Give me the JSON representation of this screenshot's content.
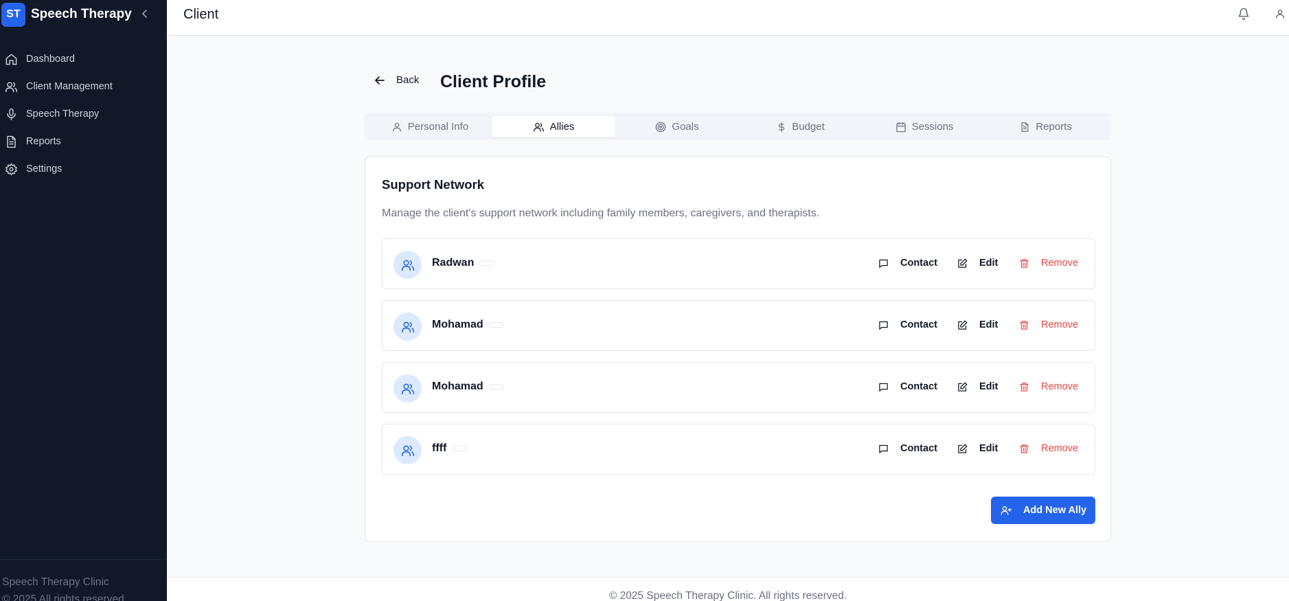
{
  "sidebar": {
    "brand_badge": "ST",
    "brand_name": "Speech Therapy",
    "items": [
      {
        "label": "Dashboard",
        "icon": "home-icon"
      },
      {
        "label": "Client Management",
        "icon": "users-icon"
      },
      {
        "label": "Speech Therapy",
        "icon": "microphone-icon"
      },
      {
        "label": "Reports",
        "icon": "file-text-icon"
      },
      {
        "label": "Settings",
        "icon": "gear-icon"
      }
    ],
    "footer_line1": "Speech Therapy Clinic",
    "footer_line2": "© 2025 All rights reserved"
  },
  "header": {
    "title": "Client"
  },
  "page": {
    "back_label": "Back",
    "title": "Client Profile"
  },
  "tabs": [
    {
      "label": "Personal Info",
      "icon": "user-icon"
    },
    {
      "label": "Allies",
      "icon": "users-icon",
      "active": true
    },
    {
      "label": "Goals",
      "icon": "target-icon"
    },
    {
      "label": "Budget",
      "icon": "dollar-icon"
    },
    {
      "label": "Sessions",
      "icon": "calendar-icon"
    },
    {
      "label": "Reports",
      "icon": "file-text-icon"
    }
  ],
  "support": {
    "title": "Support Network",
    "description": "Manage the client's support network including family members, caregivers, and therapists.",
    "allies": [
      {
        "name": "Radwan"
      },
      {
        "name": "Mohamad"
      },
      {
        "name": "Mohamad"
      },
      {
        "name": "ffff"
      }
    ],
    "actions": {
      "contact": "Contact",
      "edit": "Edit",
      "remove": "Remove"
    },
    "add_label": "Add New Ally"
  },
  "footer": {
    "text": "© 2025 Speech Therapy Clinic. All rights reserved."
  },
  "colors": {
    "sidebar_bg": "#111827",
    "accent": "#2563eb",
    "danger": "#ef4444"
  }
}
